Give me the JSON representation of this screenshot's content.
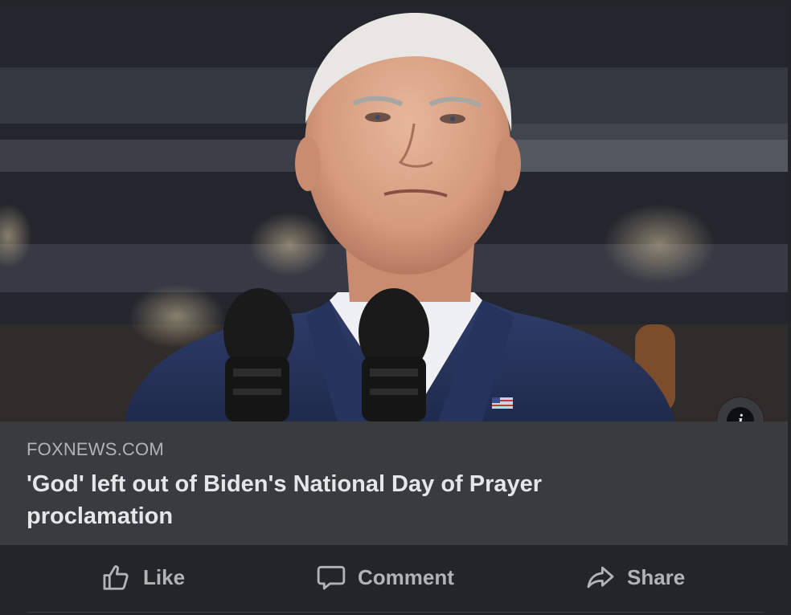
{
  "post": {
    "link_domain": "FOXNEWS.COM",
    "link_headline": "'God' left out of Biden's National Day of Prayer proclamation",
    "info_icon": "info-icon"
  },
  "actions": {
    "like_label": "Like",
    "comment_label": "Comment",
    "share_label": "Share",
    "like_icon": "thumbs-up-icon",
    "comment_icon": "speech-bubble-icon",
    "share_icon": "share-arrow-icon"
  },
  "colors": {
    "card_bg": "#242526",
    "caption_bg": "#3a3b3c",
    "primary_text": "#e4e6eb",
    "secondary_text": "#b0b3b8"
  }
}
